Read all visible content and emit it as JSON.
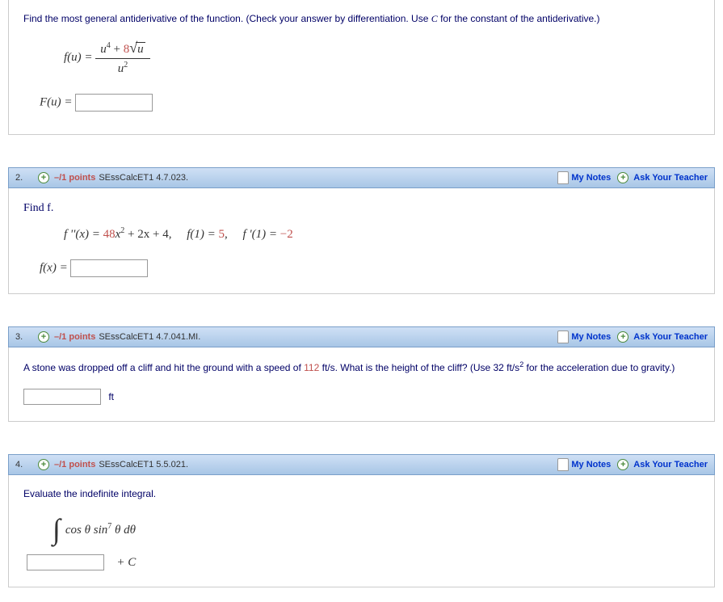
{
  "q1": {
    "prompt_a": "Find the most general antiderivative of the function. (Check your answer by differentiation. Use ",
    "prompt_c": "C",
    "prompt_b": " for the constant of the antiderivative.)",
    "fu_label": "f(u) = ",
    "Fu_label": "F(u) = ",
    "num_a": "u",
    "num_exp": "4",
    "num_plus": " + ",
    "num_coef": "8",
    "num_sqrt_arg": "u",
    "den_a": "u",
    "den_exp": "2"
  },
  "q2": {
    "num": "2.",
    "points": "–/1 points",
    "id": "SEssCalcET1 4.7.023.",
    "notes": "My Notes",
    "ask": "Ask Your Teacher",
    "find": "Find f.",
    "eq_fpp": "f ''(x) = ",
    "c48": "48",
    "x2": "x",
    "exp2": "2",
    "p2x4": " + 2x + 4,",
    "f1_lhs": "f(1) = ",
    "f1_rhs": "5",
    "comma": ",",
    "fp1_lhs": "f '(1) = ",
    "fp1_rhs": "−2",
    "fx_label": "f(x) = "
  },
  "q3": {
    "num": "3.",
    "points": "–/1 points",
    "id": "SEssCalcET1 4.7.041.MI.",
    "notes": "My Notes",
    "ask": "Ask Your Teacher",
    "text_a": "A stone was dropped off a cliff and hit the ground with a speed of ",
    "speed": "112",
    "text_b": " ft/s. What is the height of the cliff? (Use 32 ft/s",
    "exp": "2",
    "text_c": " for the acceleration due to gravity.)",
    "unit": "ft"
  },
  "q4": {
    "num": "4.",
    "points": "–/1 points",
    "id": "SEssCalcET1 5.5.021.",
    "notes": "My Notes",
    "ask": "Ask Your Teacher",
    "prompt": "Evaluate the indefinite integral.",
    "integrand_a": "cos θ sin",
    "integrand_exp": "7",
    "integrand_b": " θ dθ",
    "plus_c": "+ C"
  }
}
